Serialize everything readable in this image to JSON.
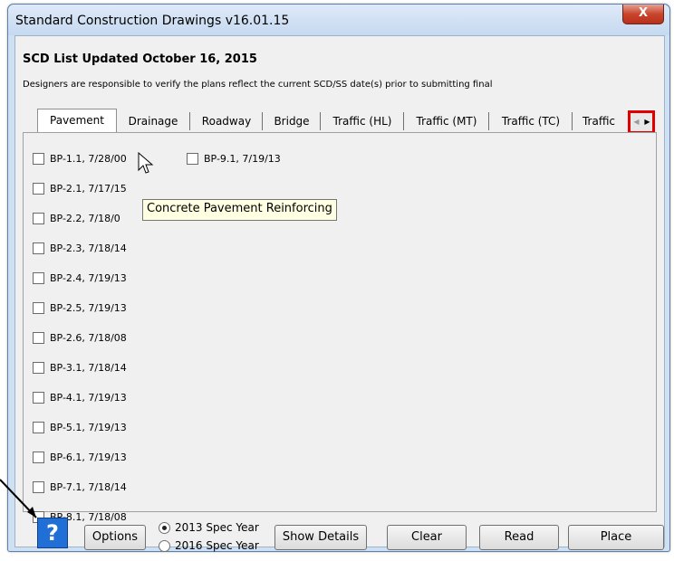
{
  "window": {
    "title": "Standard Construction Drawings  v16.01.15",
    "close_glyph": "X"
  },
  "header": {
    "title": "SCD List Updated October 16, 2015",
    "note": "Designers are responsible to verify the plans reflect the current SCD/SS date(s) prior to submitting final"
  },
  "tabs": [
    {
      "label": "Pavement"
    },
    {
      "label": "Drainage"
    },
    {
      "label": "Roadway"
    },
    {
      "label": "Bridge"
    },
    {
      "label": "Traffic (HL)"
    },
    {
      "label": "Traffic (MT)"
    },
    {
      "label": "Traffic (TC)"
    },
    {
      "label": "Traffic"
    }
  ],
  "tab_scroll": {
    "left": "◀",
    "right": "▶"
  },
  "items": [
    {
      "label": "BP-1.1, 7/28/00"
    },
    {
      "label": "BP-2.1, 7/17/15"
    },
    {
      "label": "BP-2.2, 7/18/0"
    },
    {
      "label": "BP-2.3, 7/18/14"
    },
    {
      "label": "BP-2.4, 7/19/13"
    },
    {
      "label": "BP-2.5, 7/19/13"
    },
    {
      "label": "BP-2.6, 7/18/08"
    },
    {
      "label": "BP-3.1, 7/18/14"
    },
    {
      "label": "BP-4.1, 7/19/13"
    },
    {
      "label": "BP-5.1, 7/19/13"
    },
    {
      "label": "BP-6.1, 7/19/13"
    },
    {
      "label": "BP-7.1, 7/18/14"
    },
    {
      "label": "BP-8.1, 7/18/08"
    },
    {
      "label": "BP-9.1, 7/19/13"
    }
  ],
  "tooltip": "Concrete Pavement Reinforcing",
  "footer": {
    "help": "?",
    "options": "Options",
    "spec_2013": "2013 Spec Year",
    "spec_2016": "2016 Spec Year",
    "show_details": "Show Details",
    "clear": "Clear",
    "read": "Read",
    "place": "Place"
  }
}
